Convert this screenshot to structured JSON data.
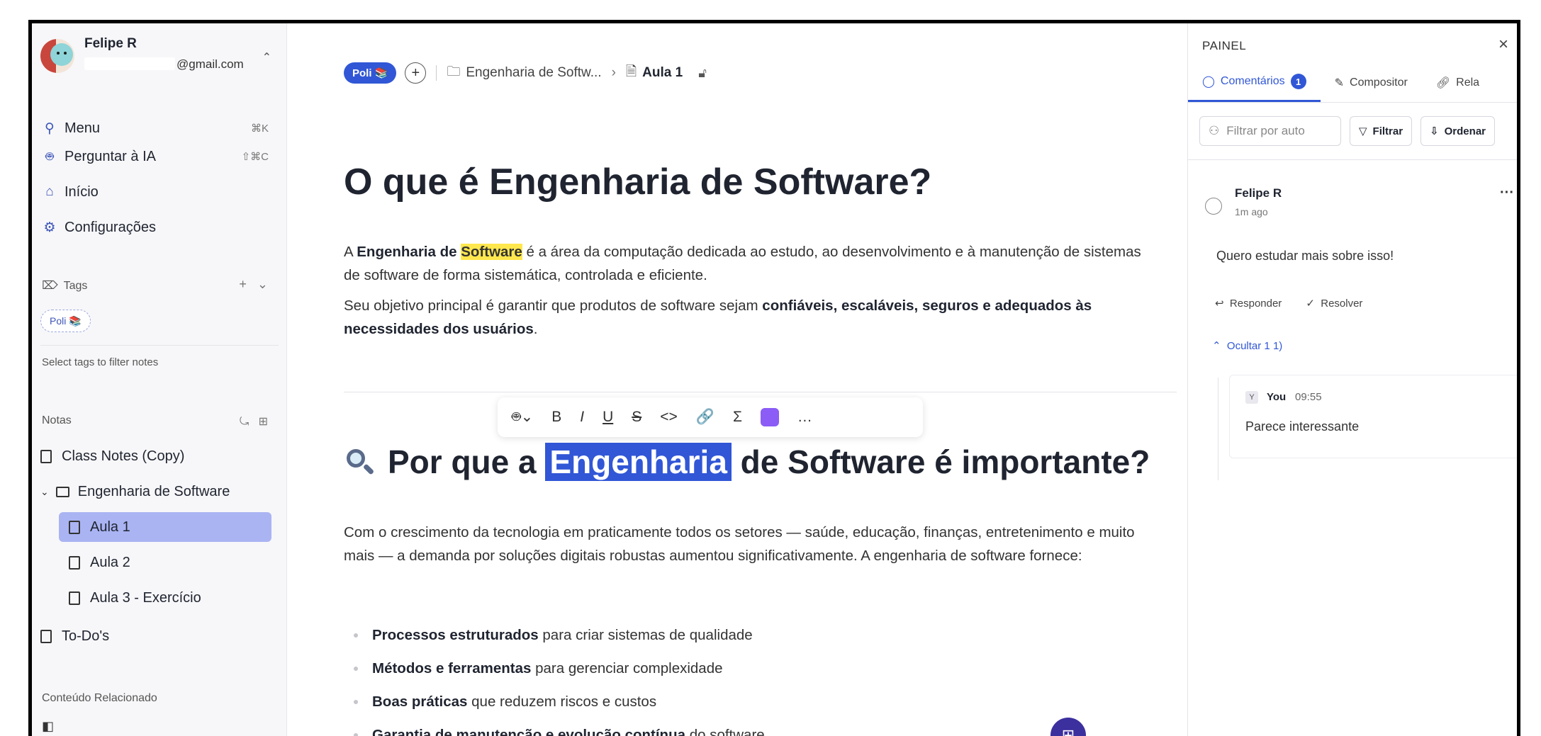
{
  "sidebar": {
    "profile": {
      "name": "Felipe R",
      "email": "@gmail.com"
    },
    "nav": [
      {
        "label": "Menu",
        "shortcut": "⌘K",
        "icon": "search-icon"
      },
      {
        "label": "Perguntar à IA",
        "shortcut": "⇧⌘C",
        "icon": "robot-icon"
      },
      {
        "label": "Início",
        "shortcut": "",
        "icon": "home-icon"
      },
      {
        "label": "Configurações",
        "shortcut": "",
        "icon": "gear-icon"
      }
    ],
    "tags": {
      "label": "Tags",
      "pill": "Poli 📚",
      "hint": "Select tags to filter notes"
    },
    "notes": {
      "label": "Notas",
      "items": [
        {
          "label": "Class Notes (Copy)"
        },
        {
          "label": "Engenharia de Software"
        },
        {
          "label": "Aula 1"
        },
        {
          "label": "Aula 2"
        },
        {
          "label": "Aula 3 - Exercício"
        },
        {
          "label": "To-Do's"
        }
      ]
    },
    "related": {
      "label": "Conteúdo Relacionado"
    }
  },
  "header": {
    "workspace_chip": "Poli 📚",
    "breadcrumb_parent": "Engenharia de Softw...",
    "breadcrumb_current": "Aula 1"
  },
  "document": {
    "title": "O que é Engenharia de Software?",
    "p1": {
      "a": "A ",
      "b": "Engenharia de ",
      "hl": "Software",
      "c": " é a área da computação dedicada ao estudo, ao desenvolvimento e à manutenção de sistemas de software de forma sistemática, controlada e eficiente."
    },
    "p2": {
      "a": "Seu objetivo principal é garantir que produtos de software sejam ",
      "b": "confiáveis, escaláveis, seguros e adequados às necessidades dos usuários",
      "c": "."
    },
    "h2": {
      "pre": "Por que a ",
      "selected": "Engenharia",
      "post": " de Software é importante?"
    },
    "p3": "Com o crescimento da tecnologia em praticamente todos os setores — saúde, educação, finanças, entretenimento e muito mais — a demanda por soluções digitais robustas aumentou significativamente. A engenharia de software fornece:",
    "bullets": [
      {
        "bold": "Processos estruturados",
        "rest": " para criar sistemas de qualidade"
      },
      {
        "bold": "Métodos e ferramentas",
        "rest": " para gerenciar complexidade"
      },
      {
        "bold": "Boas práticas",
        "rest": " que reduzem riscos e custos"
      },
      {
        "bold": "Garantia de manutenção e evolução contínua",
        "rest": " do software"
      }
    ]
  },
  "toolbar": {
    "items": [
      "B",
      "I",
      "U",
      "S",
      "<>",
      "🔗",
      "Σ",
      "…"
    ],
    "highlight_color": "#8b5cf6"
  },
  "panel": {
    "title": "PAINEL",
    "tabs": [
      {
        "label": "Comentários",
        "badge": "1"
      },
      {
        "label": "Compositor"
      },
      {
        "label": "Rela"
      }
    ],
    "filter_placeholder": "Filtrar por auto",
    "filter_label": "Filtrar",
    "sort_label": "Ordenar",
    "comment": {
      "author": "Felipe R",
      "time": "1m ago",
      "text": "Quero estudar mais sobre isso!",
      "reply_label": "Responder",
      "resolve_label": "Resolver",
      "hide_label": "Ocultar 1 1)"
    },
    "reply": {
      "author": "You",
      "time": "09:55",
      "text": "Parece interessante"
    }
  },
  "colors": {
    "accent": "#3157d6",
    "active_note": "#aab4f3",
    "highlight": "#ffe74d"
  }
}
